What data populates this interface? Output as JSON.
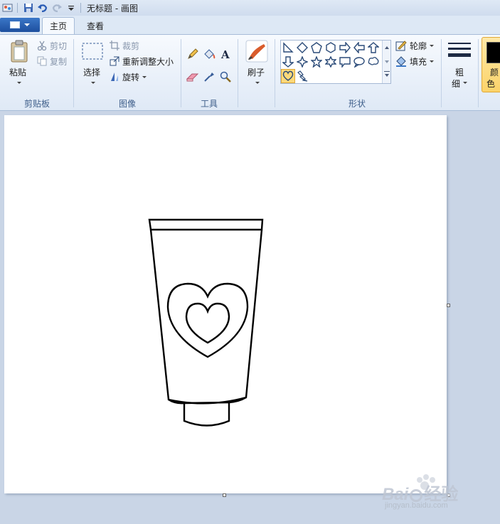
{
  "titlebar": {
    "title": "无标题 - 画图"
  },
  "tabs": {
    "home": "主页",
    "view": "查看"
  },
  "clipboard": {
    "paste": "粘贴",
    "cut": "剪切",
    "copy": "复制",
    "group": "剪贴板"
  },
  "image": {
    "select": "选择",
    "crop": "裁剪",
    "resize": "重新调整大小",
    "rotate": "旋转",
    "group": "图像"
  },
  "tools": {
    "group": "工具"
  },
  "brushes": {
    "label": "刷子"
  },
  "shapes": {
    "outline": "轮廓",
    "fill": "填充",
    "group": "形状"
  },
  "size": {
    "label_line1": "粗",
    "label_line2": "细"
  },
  "color": {
    "label_line1": "颜",
    "label_line2": "色",
    "current": "#000000"
  },
  "watermark": {
    "brand": "Bai",
    "brand_suffix": "经验",
    "url": "jingyan.baidu.com"
  }
}
